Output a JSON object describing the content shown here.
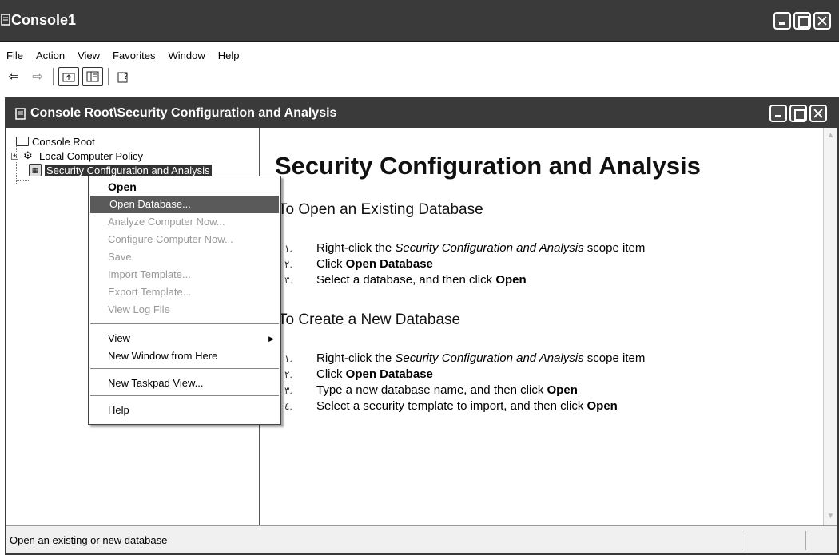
{
  "app": {
    "title": "Console1"
  },
  "menubar": [
    "File",
    "Action",
    "View",
    "Favorites",
    "Window",
    "Help"
  ],
  "toolbar": {
    "back_icon": "back-arrow-icon",
    "forward_icon": "forward-arrow-icon",
    "up_icon": "up-one-level-icon",
    "show_tree_icon": "show-hide-tree-icon",
    "help_icon": "help-icon"
  },
  "child": {
    "title": "Console Root\\Security Configuration and Analysis"
  },
  "tree": {
    "root": "Console Root",
    "items": [
      "Local Computer Policy",
      "Security Configuration and Analysis"
    ]
  },
  "context_menu": {
    "items": [
      {
        "label": "Open",
        "style": "bold"
      },
      {
        "label": "Open Database...",
        "style": "highlighted"
      },
      {
        "label": "Analyze Computer Now...",
        "style": "disabled"
      },
      {
        "label": "Configure Computer Now...",
        "style": "disabled"
      },
      {
        "label": "Save",
        "style": "disabled"
      },
      {
        "label": "Import Template...",
        "style": "disabled"
      },
      {
        "label": "Export Template...",
        "style": "disabled"
      },
      {
        "label": "View Log File",
        "style": "disabled"
      },
      {
        "label": "View",
        "style": "submenu"
      },
      {
        "label": "New Window from Here",
        "style": "normal"
      },
      {
        "label": "New Taskpad View...",
        "style": "normal"
      },
      {
        "label": "Help",
        "style": "normal"
      }
    ]
  },
  "result": {
    "heading": "Security Configuration and Analysis",
    "section1": {
      "title": "To Open an Existing Database",
      "steps": [
        {
          "num": "١.",
          "pre": "Right-click the ",
          "em": "Security Configuration and Analysis",
          "post": " scope item"
        },
        {
          "num": "٢.",
          "pre": "Click ",
          "strong": "Open Database"
        },
        {
          "num": "٣.",
          "pre": "Select a database, and then click ",
          "strong": "Open"
        }
      ]
    },
    "section2": {
      "title": "To Create a New Database",
      "steps": [
        {
          "num": "١.",
          "pre": "Right-click the ",
          "em": "Security Configuration and Analysis",
          "post": " scope item"
        },
        {
          "num": "٢.",
          "pre": "Click ",
          "strong": "Open Database"
        },
        {
          "num": "٣.",
          "pre": "Type a new database name, and then click ",
          "strong": "Open"
        },
        {
          "num": "٤.",
          "pre": "Select a security template to import, and then click ",
          "strong": "Open"
        }
      ]
    }
  },
  "status": {
    "text": "Open an existing or new database"
  }
}
